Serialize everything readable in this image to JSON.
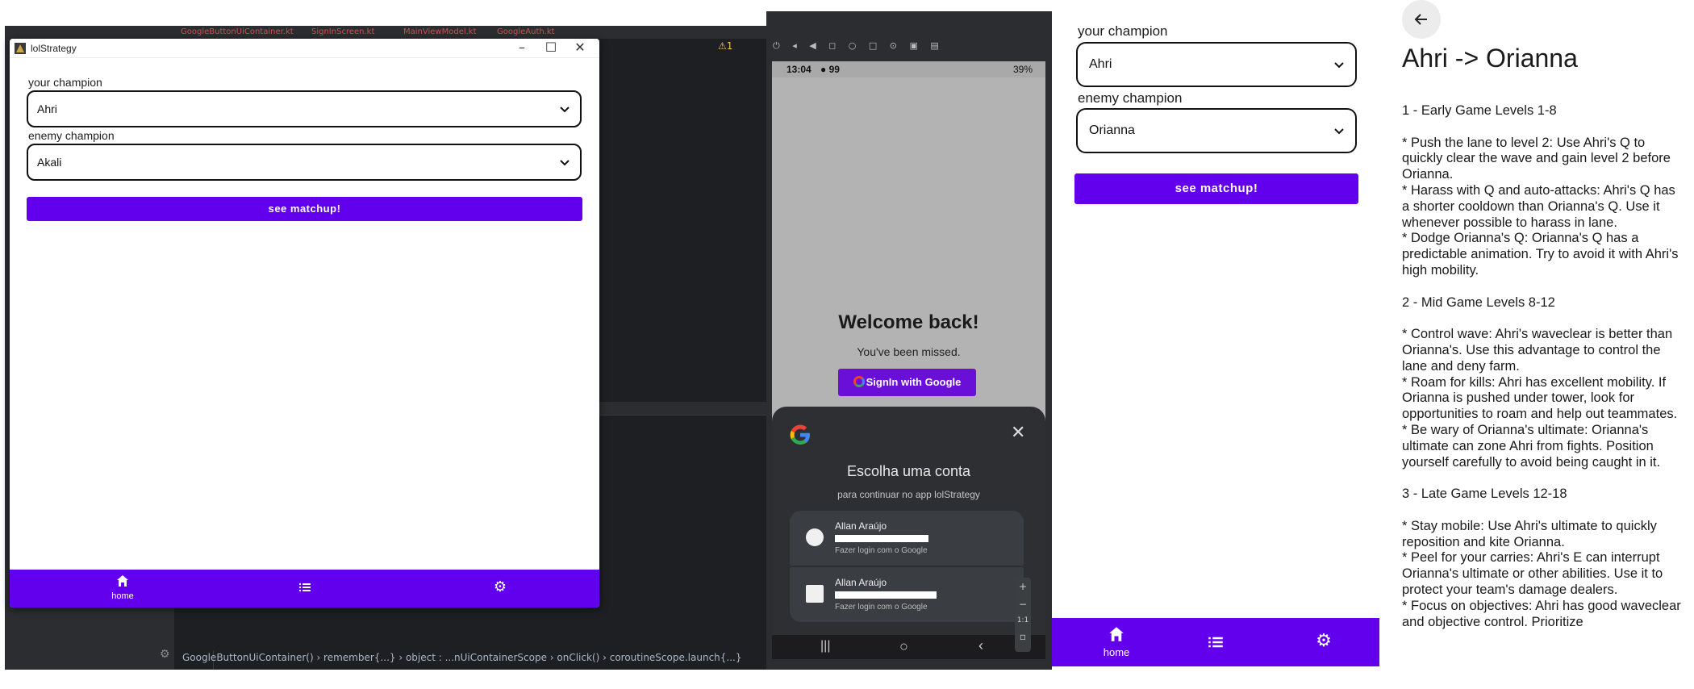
{
  "ide": {
    "tabs": [
      "GoogleButtonUiContainer.kt",
      "SignInScreen.kt",
      "MainViewModel.kt",
      "GoogleAuth.kt"
    ],
    "warning": "⚠1",
    "breadcrumbs": "GoogleButtonUiContainer()  ›  remember{...}  ›  object : ...nUiContainerScope  ›  onClick()  ›  coroutineScope.launch{...}"
  },
  "desktop_window": {
    "title": "lolStrategy",
    "controls": {
      "minimize": "–",
      "maximize": "☐",
      "close": "✕"
    },
    "your_champion_label": "your champion",
    "your_champion_value": "Ahri",
    "enemy_champion_label": "enemy champion",
    "enemy_champion_value": "Akali",
    "button_label": "see matchup!",
    "nav": {
      "home_label": "home"
    }
  },
  "emulator": {
    "status_time": "13:04",
    "status_icons": "● 99",
    "status_right": "39%",
    "welcome": "Welcome back!",
    "missed": "You've been missed.",
    "signin_button": "SignIn with Google",
    "sheet": {
      "title": "Escolha uma conta",
      "subtitle": "para continuar no app lolStrategy",
      "accounts": [
        {
          "name": "Allan Araújo",
          "action": "Fazer login com o Google"
        },
        {
          "name": "Allan Araújo",
          "action": "Fazer login com o Google"
        }
      ]
    },
    "zoom_label": "1:1"
  },
  "app2": {
    "your_champion_label": "your champion",
    "your_champion_value": "Ahri",
    "enemy_champion_label": "enemy champion",
    "enemy_champion_value": "Orianna",
    "button_label": "see matchup!",
    "nav": {
      "home_label": "home"
    }
  },
  "detail": {
    "title": "Ahri -> Orianna",
    "body": "1 - Early Game Levels 1-8\n\n* Push the lane to level 2: Use Ahri's Q to quickly clear the wave and gain level 2 before Orianna.\n* Harass with Q and auto-attacks: Ahri's Q has a shorter cooldown than Orianna's Q. Use it whenever possible to harass in lane.\n* Dodge Orianna's Q: Orianna's Q has a predictable animation. Try to avoid it with Ahri's high mobility.\n\n2 - Mid Game Levels 8-12\n\n* Control wave: Ahri's waveclear is better than Orianna's. Use this advantage to control the lane and deny farm.\n* Roam for kills: Ahri has excellent mobility. If Orianna is pushed under tower, look for opportunities to roam and help out teammates.\n* Be wary of Orianna's ultimate: Orianna's ultimate can zone Ahri from fights. Position yourself carefully to avoid being caught in it.\n\n3 - Late Game Levels 12-18\n\n* Stay mobile: Use Ahri's ultimate to quickly reposition and kite Orianna.\n* Peel for your carries: Ahri's E can interrupt Orianna's ultimate or other abilities. Use it to protect your team's damage dealers.\n* Focus on objectives: Ahri has good waveclear and objective control. Prioritize"
  },
  "colors": {
    "accent": "#6200ee",
    "ide_bg": "#1e1f22",
    "sheet_bg": "#2d2f33"
  }
}
